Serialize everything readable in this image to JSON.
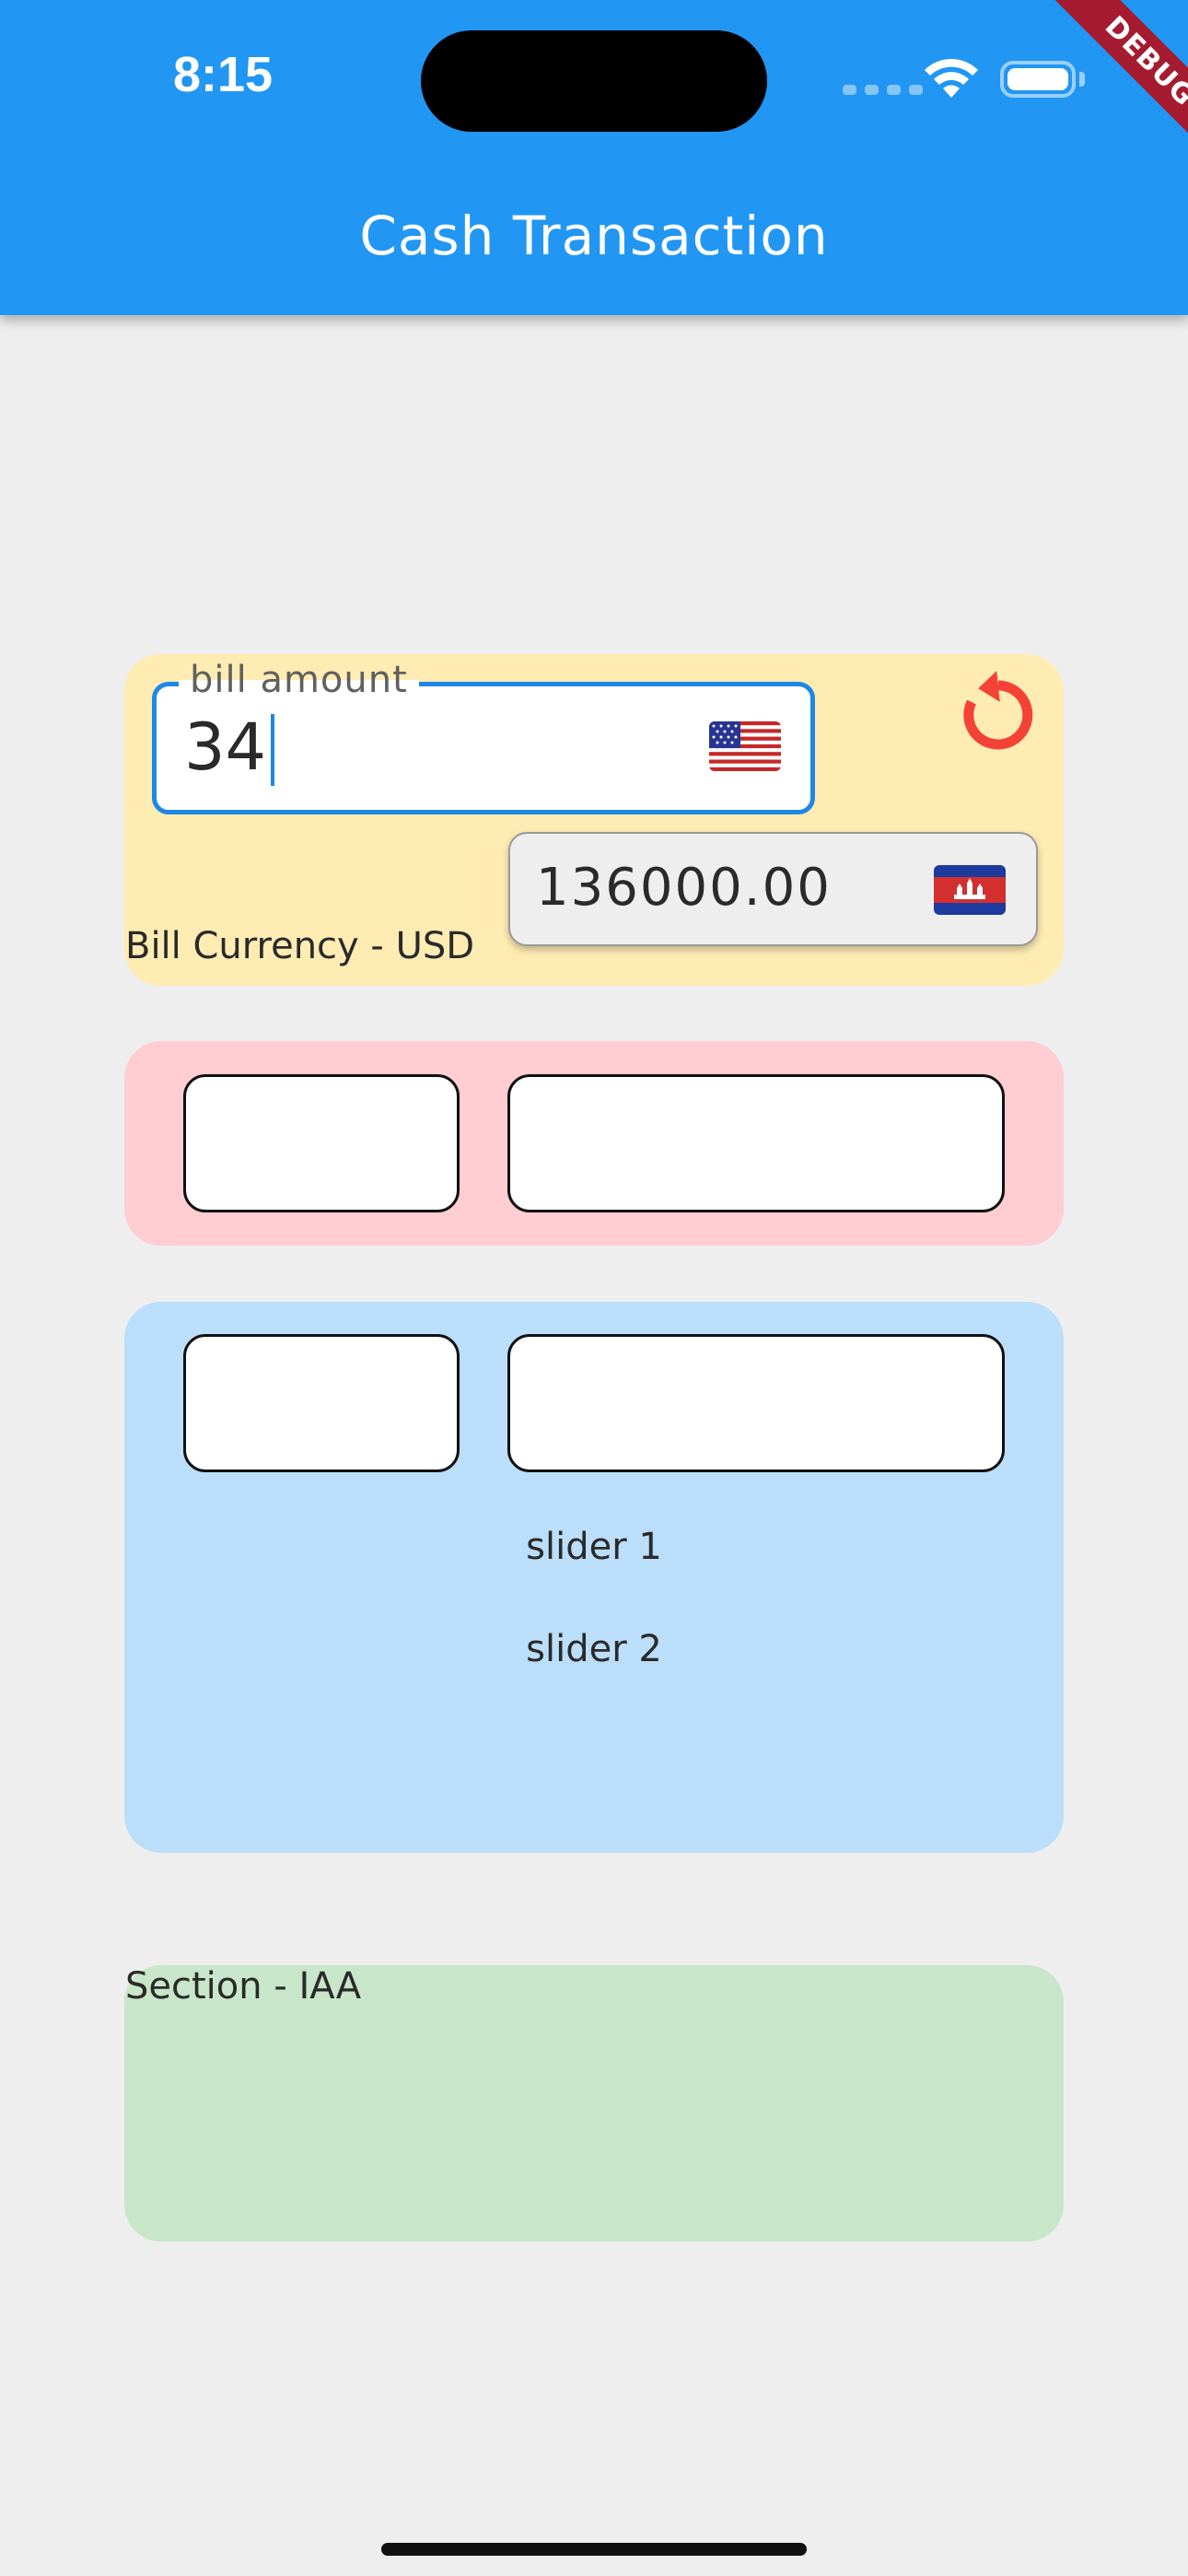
{
  "status_bar": {
    "time": "8:15"
  },
  "app_bar": {
    "title": "Cash Transaction",
    "background_color": "#2196f3",
    "debug_label": "DEBUG"
  },
  "bill_section": {
    "background_color": "#ffecb3",
    "bill_amount_label": "bill amount",
    "bill_amount_value": "34",
    "bill_flag_icon": "us-flag-icon",
    "reset_icon": "refresh-icon",
    "reset_color": "#f44336",
    "converted_value": "136000.00",
    "converted_flag_icon": "cambodia-flag-icon",
    "bill_currency_text": "Bill Currency - USD"
  },
  "red_section": {
    "background_color": "#ffcdd2"
  },
  "blue_section": {
    "background_color": "#bbdefb",
    "slider1_label": "slider 1",
    "slider2_label": "slider 2"
  },
  "green_section": {
    "background_color": "#c8e6c9",
    "label": "Section - IAA"
  }
}
